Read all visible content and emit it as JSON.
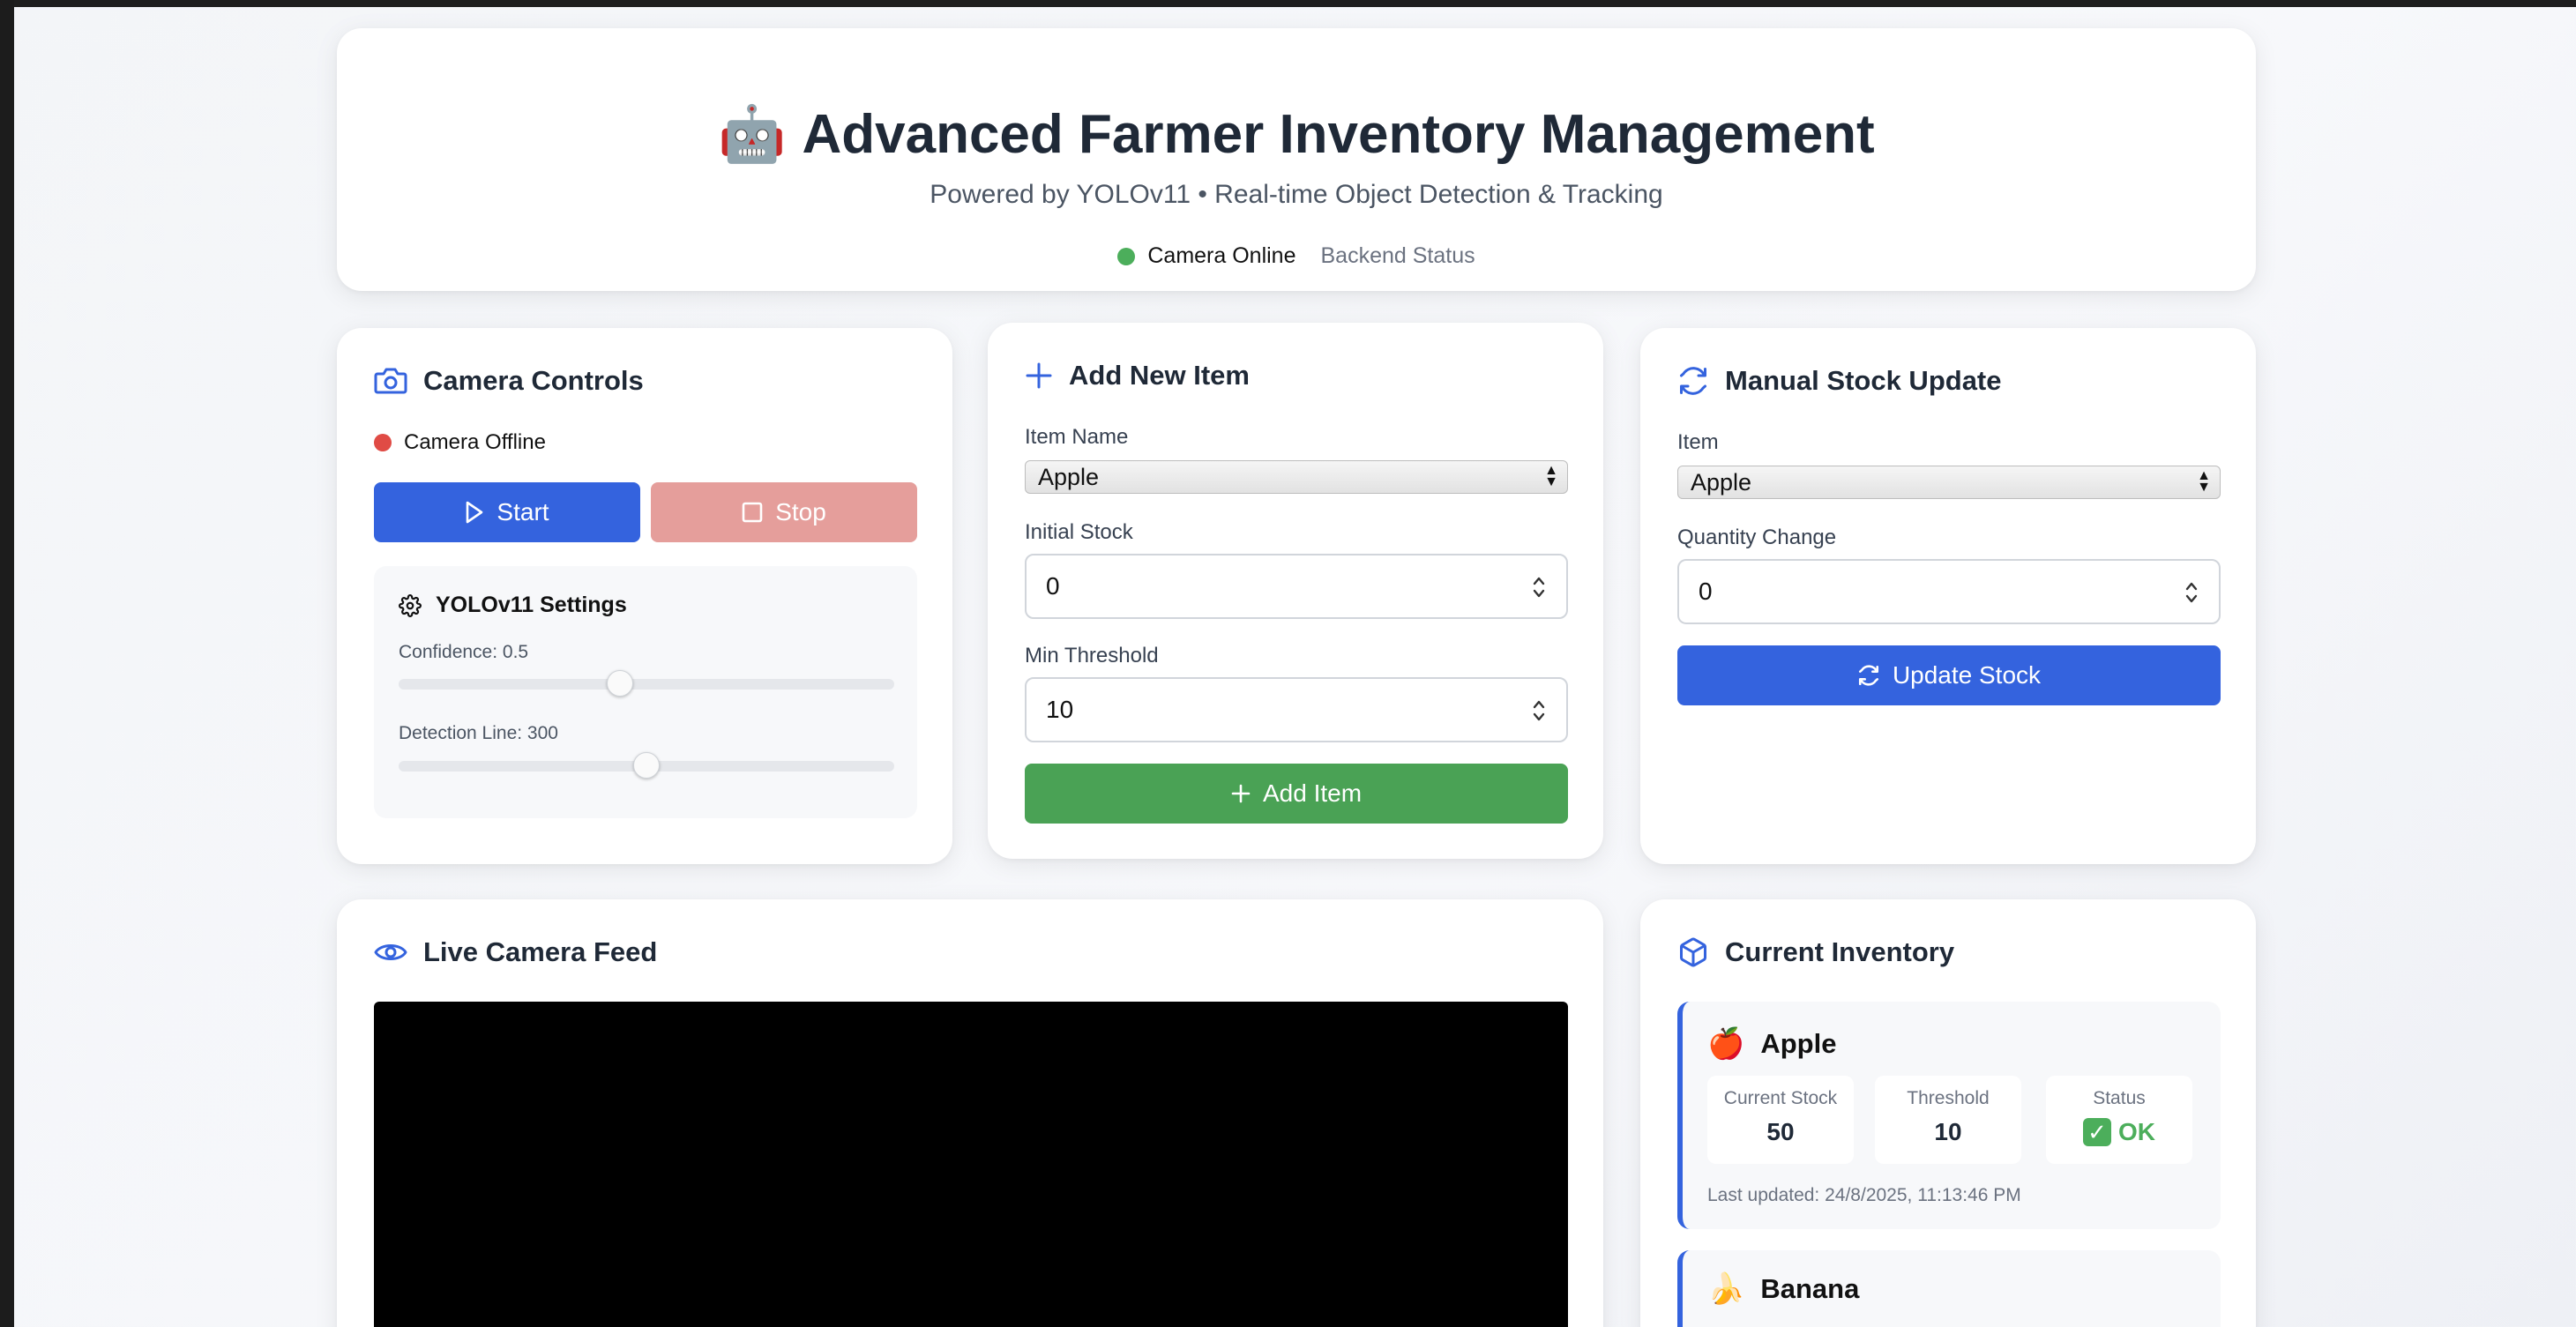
{
  "header": {
    "emoji": "🤖",
    "title": "Advanced Farmer Inventory Management",
    "subtitle": "Powered by YOLOv11 • Real-time Object Detection & Tracking",
    "camera_status": "Camera Online",
    "backend_status": "Backend Status",
    "camera_status_color": "#4cae5b"
  },
  "camera_controls": {
    "title": "Camera Controls",
    "status": "Camera Offline",
    "status_color": "#e04b45",
    "start_label": "Start",
    "stop_label": "Stop",
    "settings_title": "YOLOv11 Settings",
    "confidence_label": "Confidence: 0.5",
    "confidence_value": 0.5,
    "detection_line_label": "Detection Line: 300",
    "detection_line_value": 300
  },
  "add_item": {
    "title": "Add New Item",
    "item_name_label": "Item Name",
    "item_name_value": "Apple",
    "initial_stock_label": "Initial Stock",
    "initial_stock_value": "0",
    "min_threshold_label": "Min Threshold",
    "min_threshold_value": "10",
    "button_label": "Add Item",
    "button_color": "#4aa255"
  },
  "manual_update": {
    "title": "Manual Stock Update",
    "item_label": "Item",
    "item_value": "Apple",
    "quantity_label": "Quantity Change",
    "quantity_value": "0",
    "button_label": "Update Stock",
    "button_color": "#3463de"
  },
  "live_feed": {
    "title": "Live Camera Feed"
  },
  "inventory": {
    "title": "Current Inventory",
    "items": [
      {
        "emoji": "🍎",
        "name": "Apple",
        "current_stock_label": "Current Stock",
        "current_stock": "50",
        "threshold_label": "Threshold",
        "threshold": "10",
        "status_label": "Status",
        "status": "OK",
        "status_icon": "✓",
        "last_updated": "Last updated: 24/8/2025, 11:13:46 PM"
      },
      {
        "emoji": "🍌",
        "name": "Banana"
      }
    ]
  }
}
